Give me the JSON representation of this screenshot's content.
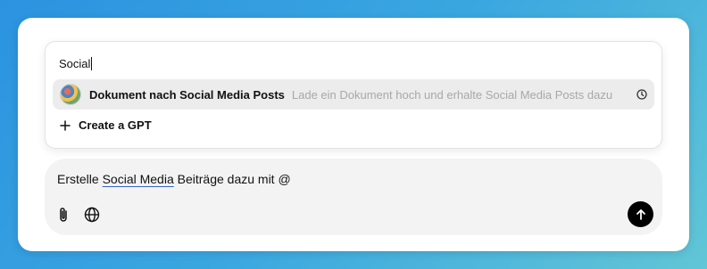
{
  "search": {
    "query": "Social"
  },
  "suggestions": [
    {
      "title": "Dokument nach Social Media Posts",
      "description": "Lade ein Dokument hoch und erhalte Social Media Posts dazu",
      "icon": "gpt-avatar-thumbnail",
      "trailing_icon": "clock-icon"
    }
  ],
  "create_gpt": {
    "label": "Create a GPT",
    "icon": "plus-icon"
  },
  "composer": {
    "text_before": "Erstelle ",
    "text_underlined": "Social Media",
    "text_after": " Beiträge dazu mit @",
    "tools": [
      "paperclip-icon",
      "globe-icon"
    ],
    "send_icon": "arrow-up-icon"
  },
  "colors": {
    "background_start": "#2b93e0",
    "background_end": "#62c6d6",
    "highlight_row": "#ececec",
    "composer_bg": "#f3f3f3",
    "send_button": "#000000",
    "underline": "#3a63c9"
  }
}
